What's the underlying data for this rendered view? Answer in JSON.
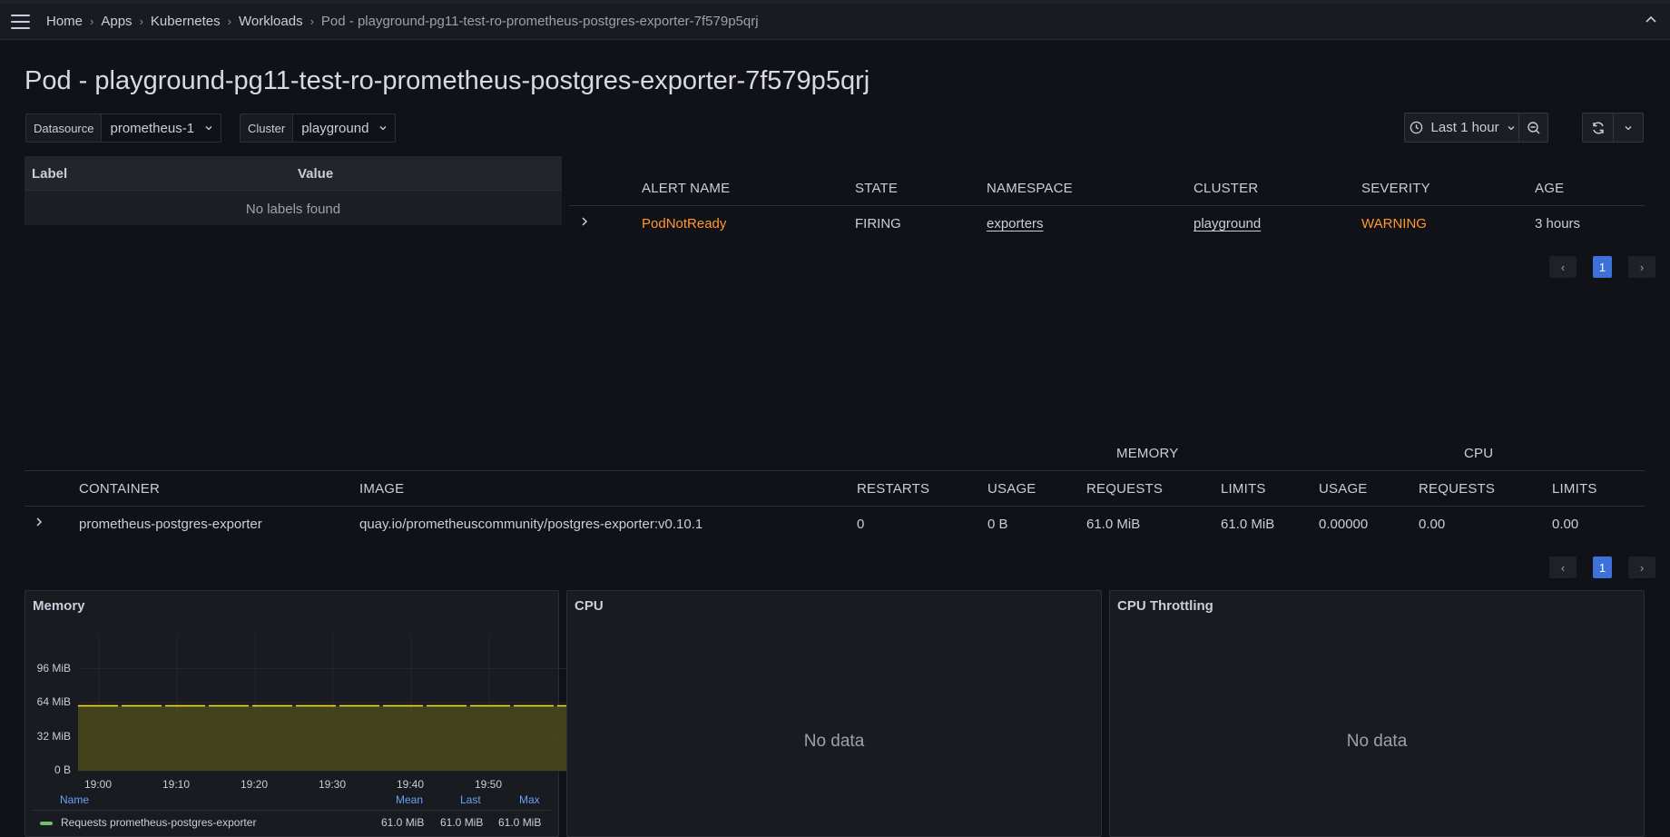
{
  "breadcrumbs": {
    "items": [
      "Home",
      "Apps",
      "Kubernetes",
      "Workloads"
    ],
    "current": "Pod - playground-pg11-test-ro-prometheus-postgres-exporter-7f579p5qrj"
  },
  "page": {
    "title": "Pod - playground-pg11-test-ro-prometheus-postgres-exporter-7f579p5qrj"
  },
  "variables": {
    "datasource": {
      "label": "Datasource",
      "value": "prometheus-1"
    },
    "cluster": {
      "label": "Cluster",
      "value": "playground"
    }
  },
  "time_picker": {
    "label": "Last 1 hour"
  },
  "labels_table": {
    "headers": [
      "Label",
      "Value"
    ],
    "empty_text": "No labels found"
  },
  "alerts_table": {
    "headers": [
      "ALERT NAME",
      "STATE",
      "NAMESPACE",
      "CLUSTER",
      "SEVERITY",
      "AGE"
    ],
    "rows": [
      {
        "alert_name": "PodNotReady",
        "state": "FIRING",
        "namespace": "exporters",
        "cluster": "playground",
        "severity": "WARNING",
        "age": "3 hours"
      }
    ],
    "page": "1"
  },
  "containers_table": {
    "group_headers": {
      "memory": "MEMORY",
      "cpu": "CPU"
    },
    "headers": [
      "CONTAINER",
      "IMAGE",
      "RESTARTS",
      "USAGE",
      "REQUESTS",
      "LIMITS",
      "USAGE",
      "REQUESTS",
      "LIMITS"
    ],
    "rows": [
      {
        "container": "prometheus-postgres-exporter",
        "image": "quay.io/prometheuscommunity/postgres-exporter:v0.10.1",
        "restarts": "0",
        "mem_usage": "0 B",
        "mem_requests": "61.0 MiB",
        "mem_limits": "61.0 MiB",
        "cpu_usage": "0.00000",
        "cpu_requests": "0.00",
        "cpu_limits": "0.00"
      }
    ],
    "page": "1"
  },
  "panels": {
    "memory": {
      "title": "Memory",
      "legend": {
        "headers": {
          "name": "Name",
          "mean": "Mean",
          "last": "Last",
          "max": "Max"
        },
        "series_name": "Requests prometheus-postgres-exporter",
        "mean": "61.0 MiB",
        "last": "61.0 MiB",
        "max": "61.0 MiB",
        "color": "#73bf69"
      }
    },
    "cpu": {
      "title": "CPU",
      "empty_text": "No data"
    },
    "cpu_throttling": {
      "title": "CPU Throttling",
      "empty_text": "No data"
    }
  },
  "colors": {
    "background": "#111217",
    "accent_blue": "#3d71d9",
    "warning_orange": "#ff9830",
    "series_yellow": "#fade2a"
  },
  "chart_data": {
    "type": "area",
    "title": "Memory",
    "x": [
      "19:00",
      "19:10",
      "19:20",
      "19:30",
      "19:40",
      "19:50"
    ],
    "yticks": [
      "0 B",
      "32 MiB",
      "64 MiB",
      "96 MiB"
    ],
    "ylim": [
      0,
      128
    ],
    "series": [
      {
        "name": "Requests prometheus-postgres-exporter",
        "values": [
          61,
          61,
          61,
          61,
          61,
          61
        ]
      }
    ],
    "grid": true,
    "legend": "bottom"
  }
}
